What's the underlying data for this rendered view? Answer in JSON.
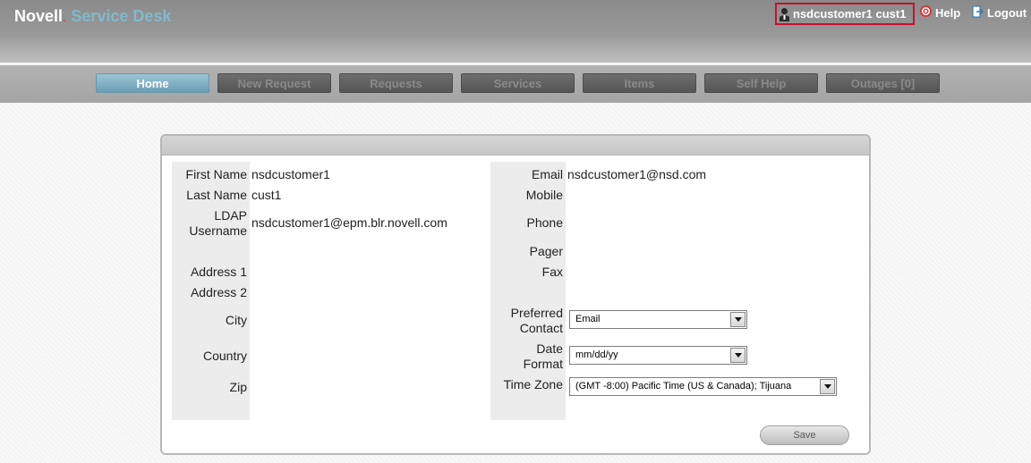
{
  "brand": {
    "name_part1": "Novell",
    "name_part2": "Service Desk"
  },
  "user": {
    "display_name": "nsdcustomer1 cust1"
  },
  "toplinks": {
    "help": "Help",
    "logout": "Logout"
  },
  "nav": {
    "tabs": [
      {
        "label": "Home",
        "active": true
      },
      {
        "label": "New Request",
        "active": false
      },
      {
        "label": "Requests",
        "active": false
      },
      {
        "label": "Services",
        "active": false
      },
      {
        "label": "Items",
        "active": false
      },
      {
        "label": "Self Help",
        "active": false
      },
      {
        "label": "Outages [0]",
        "active": false
      }
    ]
  },
  "profile": {
    "left": {
      "first_name": {
        "label": "First Name",
        "value": "nsdcustomer1"
      },
      "last_name": {
        "label": "Last Name",
        "value": "cust1"
      },
      "ldap_username": {
        "label_line1": "LDAP",
        "label_line2": "Username",
        "value": "nsdcustomer1@epm.blr.novell.com"
      },
      "address1": {
        "label": "Address 1",
        "value": ""
      },
      "address2": {
        "label": "Address 2",
        "value": ""
      },
      "city": {
        "label": "City",
        "value": ""
      },
      "country": {
        "label": "Country",
        "value": ""
      },
      "zip": {
        "label": "Zip",
        "value": ""
      }
    },
    "right": {
      "email": {
        "label": "Email",
        "value": "nsdcustomer1@nsd.com"
      },
      "mobile": {
        "label": "Mobile",
        "value": ""
      },
      "phone": {
        "label": "Phone",
        "value": ""
      },
      "pager": {
        "label": "Pager",
        "value": ""
      },
      "fax": {
        "label": "Fax",
        "value": ""
      },
      "preferred_contact": {
        "label_line1": "Preferred",
        "label_line2": "Contact",
        "selected": "Email"
      },
      "date_format": {
        "label_line1": "Date",
        "label_line2": "Format",
        "selected": "mm/dd/yy"
      },
      "time_zone": {
        "label": "Time Zone",
        "selected": "(GMT -8:00) Pacific Time (US & Canada); Tijuana"
      }
    }
  },
  "actions": {
    "save": "Save"
  },
  "colors": {
    "active_tab": "#7fb0c6",
    "brand_accent": "#7fb9cc",
    "highlight_border": "#c8102e"
  }
}
